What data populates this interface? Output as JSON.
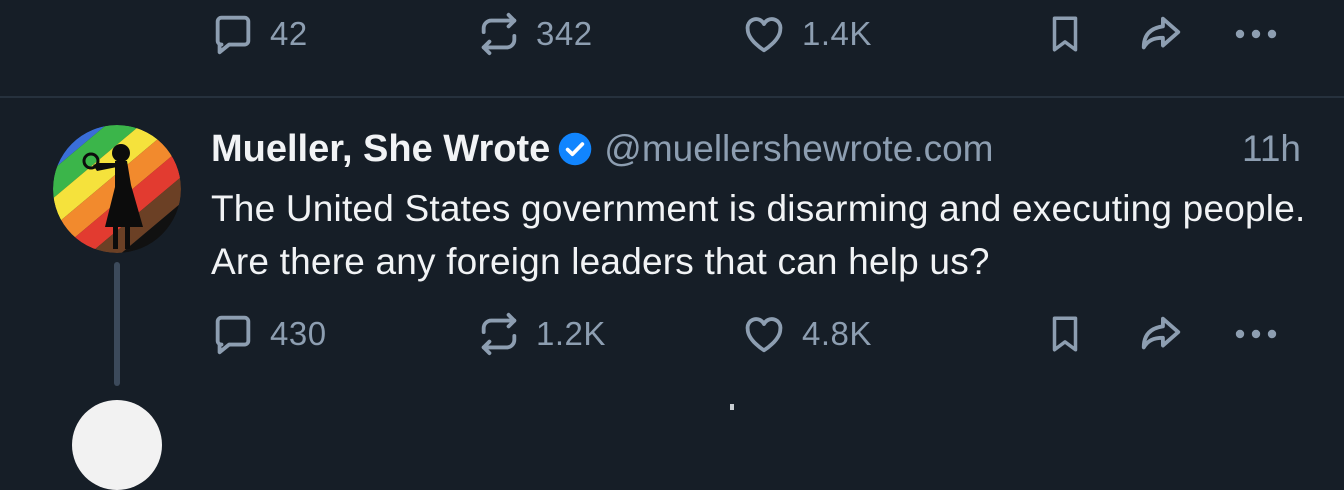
{
  "previous_post": {
    "actions": {
      "reply": {
        "icon": "reply-icon",
        "count": "42"
      },
      "repost": {
        "icon": "repost-icon",
        "count": "342"
      },
      "like": {
        "icon": "heart-icon",
        "count": "1.4K"
      },
      "bookmark": {
        "icon": "bookmark-icon"
      },
      "share": {
        "icon": "share-icon"
      },
      "more": {
        "icon": "more-icon"
      }
    }
  },
  "post": {
    "author_name": "Mueller, She Wrote",
    "verified": true,
    "handle": "@muellershewrote.com",
    "timestamp": "11h",
    "text": "The United States government is disarming and executing people. Are there any foreign leaders that can help us?",
    "actions": {
      "reply": {
        "icon": "reply-icon",
        "count": "430"
      },
      "repost": {
        "icon": "repost-icon",
        "count": "1.2K"
      },
      "like": {
        "icon": "heart-icon",
        "count": "4.8K"
      },
      "bookmark": {
        "icon": "bookmark-icon"
      },
      "share": {
        "icon": "share-icon"
      },
      "more": {
        "icon": "more-icon"
      }
    }
  },
  "colors": {
    "background": "#161e27",
    "text_primary": "#f1f3f5",
    "text_secondary": "#8d9eb1",
    "divider": "#26313d",
    "verified": "#1185fe",
    "thread_line": "#3c4a5b"
  }
}
